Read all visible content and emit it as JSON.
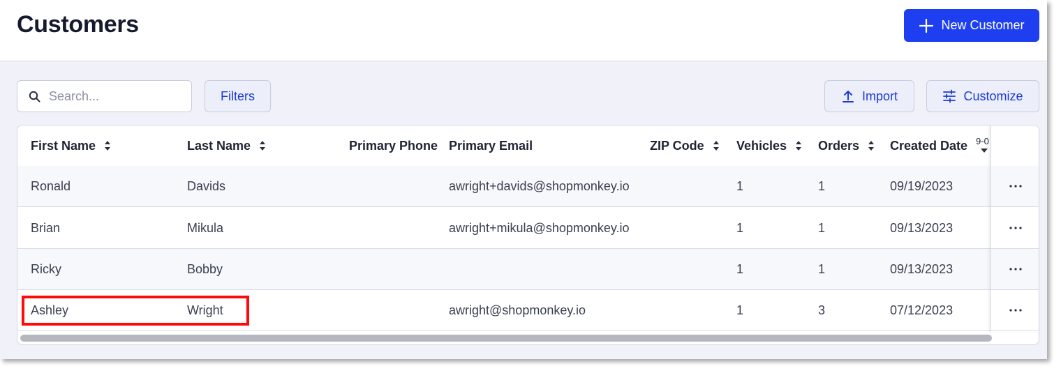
{
  "page": {
    "title": "Customers",
    "new_button_label": "New Customer"
  },
  "toolbar": {
    "search_placeholder": "Search...",
    "search_value": "",
    "filters_label": "Filters",
    "import_label": "Import",
    "customize_label": "Customize"
  },
  "table": {
    "columns": [
      {
        "label": "First Name",
        "sortable": true
      },
      {
        "label": "Last Name",
        "sortable": true
      },
      {
        "label": "Primary Phone",
        "sortable": false
      },
      {
        "label": "Primary Email",
        "sortable": false
      },
      {
        "label": "ZIP Code",
        "sortable": true
      },
      {
        "label": "Vehicles",
        "sortable": true
      },
      {
        "label": "Orders",
        "sortable": true
      },
      {
        "label": "Created Date",
        "sortable": true,
        "sort_indicator": "9-0"
      }
    ],
    "rows": [
      {
        "first_name": "Ronald",
        "last_name": "Davids",
        "phone": "",
        "email": "awright+davids@shopmonkey.io",
        "zip": "",
        "vehicles": "1",
        "orders": "1",
        "created": "09/19/2023"
      },
      {
        "first_name": "Brian",
        "last_name": "Mikula",
        "phone": "",
        "email": "awright+mikula@shopmonkey.io",
        "zip": "",
        "vehicles": "1",
        "orders": "1",
        "created": "09/13/2023"
      },
      {
        "first_name": "Ricky",
        "last_name": "Bobby",
        "phone": "",
        "email": "",
        "zip": "",
        "vehicles": "1",
        "orders": "1",
        "created": "09/13/2023"
      },
      {
        "first_name": "Ashley",
        "last_name": "Wright",
        "phone": "",
        "email": "awright@shopmonkey.io",
        "zip": "",
        "vehicles": "1",
        "orders": "3",
        "created": "07/12/2023"
      }
    ]
  },
  "colors": {
    "accent": "#1d3ff0",
    "highlight": "#ff0a0a"
  },
  "icons": {
    "new": "plus-icon",
    "search": "search-icon",
    "import": "upload-icon",
    "customize": "sliders-icon",
    "sort": "sort-icon",
    "row_actions": "more-horizontal-icon"
  }
}
